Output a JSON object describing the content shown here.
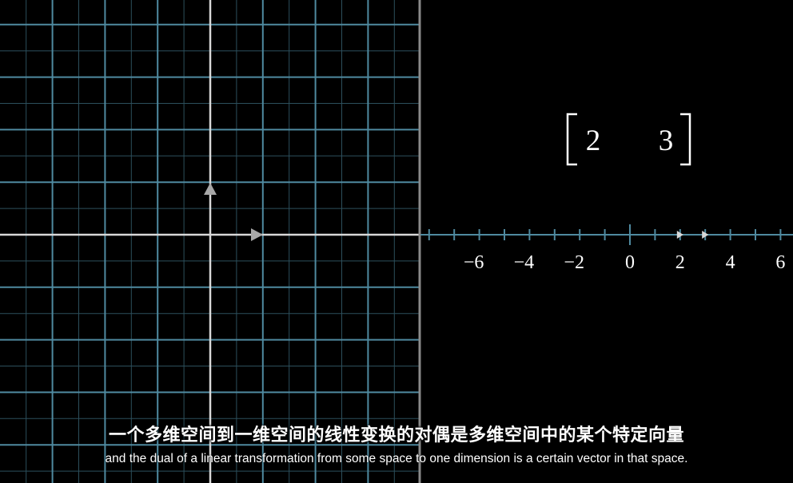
{
  "matrix": {
    "entries": [
      "2",
      "3"
    ]
  },
  "number_line": {
    "tick_labels": [
      "−6",
      "−4",
      "−2",
      "0",
      "2",
      "4",
      "6"
    ],
    "label_values": [
      -6,
      -4,
      -2,
      0,
      2,
      4,
      6
    ],
    "range": [
      -8,
      6
    ],
    "marker_values": [
      2,
      3
    ]
  },
  "grid": {
    "basis_i": [
      1,
      0
    ],
    "basis_j": [
      0,
      1
    ]
  },
  "subtitles": {
    "chinese": "一个多维空间到一维空间的线性变换的对偶是多维空间中的某个特定向量",
    "english": "and the dual of a linear transformation from some space to one dimension is a certain vector in that space."
  },
  "colors": {
    "grid": "#4f8aa0",
    "grid_faint": "#2c4f5c",
    "axis": "#d8d8d8",
    "divider": "#8a8a8a",
    "text": "#ffffff",
    "background": "#000000"
  }
}
